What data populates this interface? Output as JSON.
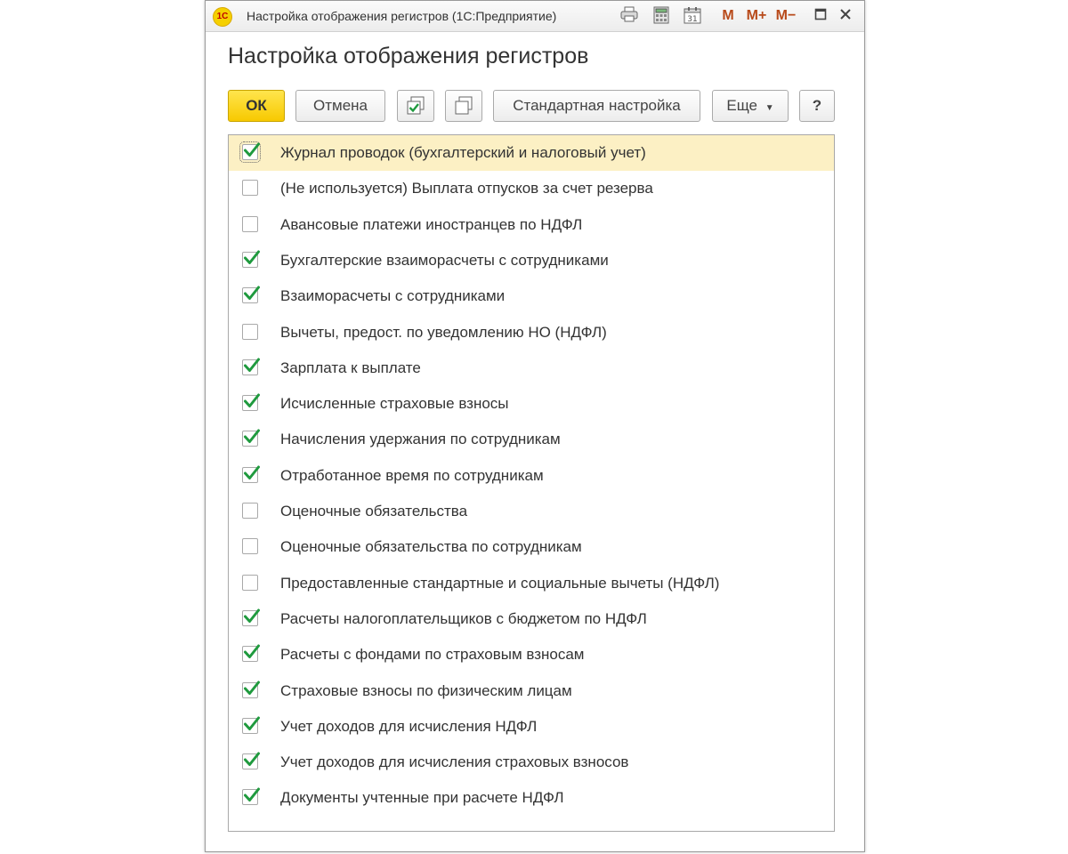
{
  "window": {
    "title": "Настройка отображения регистров (1С:Предприятие)",
    "logo_text": "1С",
    "toolbar": {
      "memory_label": "M",
      "memory_plus_label": "M+",
      "memory_minus_label": "M−"
    }
  },
  "form": {
    "title": "Настройка отображения регистров"
  },
  "buttons": {
    "ok": "ОК",
    "cancel": "Отмена",
    "standard_settings": "Стандартная настройка",
    "more": "Еще",
    "help": "?"
  },
  "colors": {
    "accent_ok": "#f7c900",
    "check_green": "#1f9a3e",
    "selected_row": "#fcf0c4"
  },
  "registers": [
    {
      "label": "Журнал проводок (бухгалтерский и налоговый учет)",
      "checked": true,
      "selected": true
    },
    {
      "label": "(Не используется) Выплата отпусков за счет резерва",
      "checked": false
    },
    {
      "label": "Авансовые платежи иностранцев по НДФЛ",
      "checked": false
    },
    {
      "label": "Бухгалтерские взаиморасчеты с сотрудниками",
      "checked": true
    },
    {
      "label": "Взаиморасчеты с сотрудниками",
      "checked": true
    },
    {
      "label": "Вычеты, предост. по уведомлению НО (НДФЛ)",
      "checked": false
    },
    {
      "label": "Зарплата к выплате",
      "checked": true
    },
    {
      "label": "Исчисленные страховые взносы",
      "checked": true
    },
    {
      "label": "Начисления удержания по сотрудникам",
      "checked": true
    },
    {
      "label": "Отработанное время по сотрудникам",
      "checked": true
    },
    {
      "label": "Оценочные обязательства",
      "checked": false
    },
    {
      "label": "Оценочные обязательства по сотрудникам",
      "checked": false
    },
    {
      "label": "Предоставленные стандартные и социальные вычеты (НДФЛ)",
      "checked": false
    },
    {
      "label": "Расчеты налогоплательщиков с бюджетом по НДФЛ",
      "checked": true
    },
    {
      "label": "Расчеты с фондами по страховым взносам",
      "checked": true
    },
    {
      "label": "Страховые взносы по физическим лицам",
      "checked": true
    },
    {
      "label": "Учет доходов для исчисления НДФЛ",
      "checked": true
    },
    {
      "label": "Учет доходов для исчисления страховых взносов",
      "checked": true
    },
    {
      "label": "Документы учтенные при расчете НДФЛ",
      "checked": true
    }
  ]
}
